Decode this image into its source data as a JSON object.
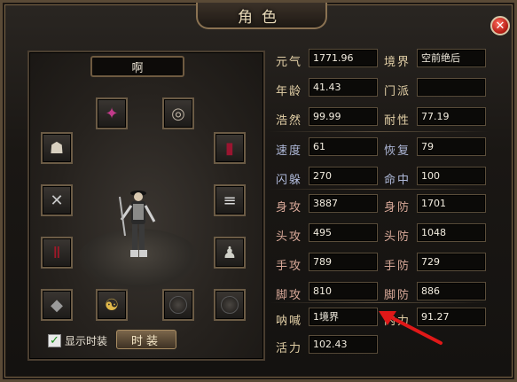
{
  "window": {
    "title": "角色",
    "close_glyph": "✕"
  },
  "character": {
    "name": "啊",
    "show_fashion_label": "显示时装",
    "show_fashion_checked": true,
    "fashion_button_label": "时装",
    "equipment_slots": [
      {
        "id": "slot-top-left",
        "icon": "helmet-icon",
        "glyph": "✦"
      },
      {
        "id": "slot-top-right",
        "icon": "ring-icon",
        "glyph": "◎"
      },
      {
        "id": "slot-row2-left",
        "icon": "armor-icon",
        "glyph": "☗"
      },
      {
        "id": "slot-row2-right",
        "icon": "robe-icon",
        "glyph": "▮"
      },
      {
        "id": "slot-row3-left",
        "icon": "weapon-icon",
        "glyph": "✕"
      },
      {
        "id": "slot-row3-right",
        "icon": "bracer-icon",
        "glyph": "≡"
      },
      {
        "id": "slot-row4-left",
        "icon": "pants-icon",
        "glyph": "Ⅱ"
      },
      {
        "id": "slot-row4-right",
        "icon": "boots-icon",
        "glyph": "♟"
      },
      {
        "id": "slot-bottom-1",
        "icon": "gem-icon",
        "glyph": "◆"
      },
      {
        "id": "slot-bottom-2",
        "icon": "yinyang-icon",
        "glyph": "☯"
      },
      {
        "id": "slot-bottom-3",
        "icon": "empty-slot-icon",
        "glyph": ""
      },
      {
        "id": "slot-bottom-4",
        "icon": "empty-slot-icon",
        "glyph": ""
      }
    ]
  },
  "stats": {
    "yuanqi": {
      "label": "元气",
      "value": "1771.96"
    },
    "jingjie": {
      "label": "境界",
      "value": "空前绝后"
    },
    "nianling": {
      "label": "年龄",
      "value": "41.43"
    },
    "menpai": {
      "label": "门派",
      "value": ""
    },
    "haoran": {
      "label": "浩然",
      "value": "99.99"
    },
    "naixing": {
      "label": "耐性",
      "value": "77.19"
    },
    "sudu": {
      "label": "速度",
      "value": "61"
    },
    "huifu": {
      "label": "恢复",
      "value": "79"
    },
    "shanduo": {
      "label": "闪躲",
      "value": "270"
    },
    "mingzhong": {
      "label": "命中",
      "value": "100"
    },
    "shengong": {
      "label": "身攻",
      "value": "3887"
    },
    "shenfang": {
      "label": "身防",
      "value": "1701"
    },
    "tougong": {
      "label": "头攻",
      "value": "495"
    },
    "toufang": {
      "label": "头防",
      "value": "1048"
    },
    "shougong": {
      "label": "手攻",
      "value": "789"
    },
    "shoufang": {
      "label": "手防",
      "value": "729"
    },
    "jiaogong": {
      "label": "脚攻",
      "value": "810"
    },
    "jiaofang": {
      "label": "脚防",
      "value": "886"
    },
    "nahan": {
      "label": "呐喊",
      "value": "1境界"
    },
    "neili": {
      "label": "内力",
      "value": "91.27"
    },
    "huoli": {
      "label": "活力",
      "value": "102.43"
    }
  },
  "colors": {
    "annotation_arrow": "#e01818",
    "label_gold": "#e2cfa6"
  }
}
